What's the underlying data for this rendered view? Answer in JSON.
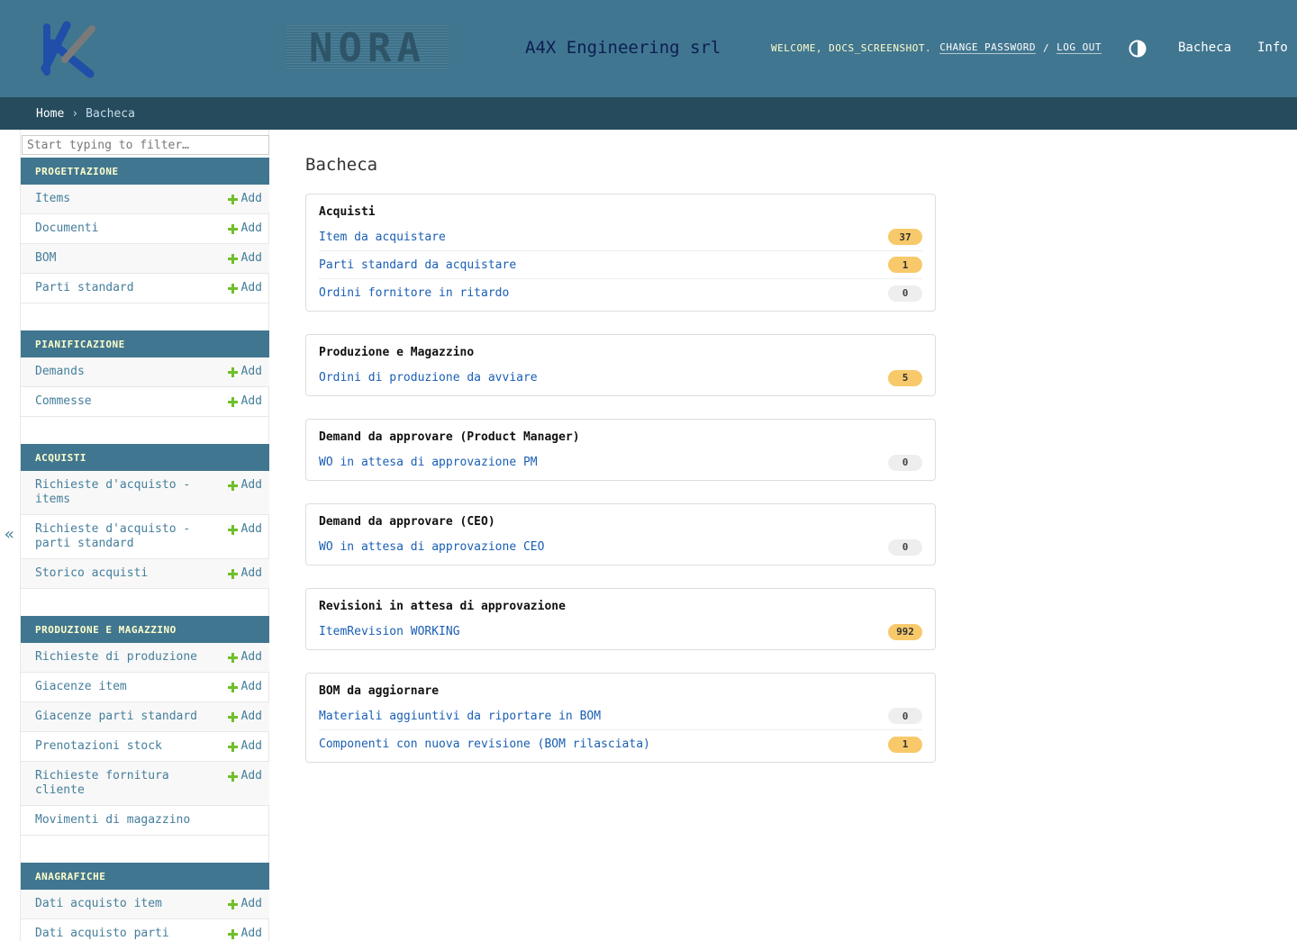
{
  "header": {
    "company": "A4X Engineering srl",
    "nora_logo_text": "NORA",
    "welcome": "WELCOME, DOCS_SCREENSHOT.",
    "change_password": "CHANGE PASSWORD",
    "separator": "/",
    "logout": "LOG OUT",
    "nav": [
      "Bacheca",
      "Info"
    ],
    "colors": {
      "header_bg": "#417690",
      "breadcrumb_bg": "#264b5d",
      "logo_blue": "#1f4fa8",
      "logo_gray": "#7a7a7a"
    }
  },
  "breadcrumb": {
    "home": "Home",
    "sep": "›",
    "current": "Bacheca"
  },
  "sidebar": {
    "filter_placeholder": "Start typing to filter…",
    "collapse_icon": "«",
    "add_label": "Add",
    "modules": [
      {
        "title": "PROGETTAZIONE",
        "items": [
          {
            "label": "Items",
            "add": true
          },
          {
            "label": "Documenti",
            "add": true
          },
          {
            "label": "BOM",
            "add": true
          },
          {
            "label": "Parti standard",
            "add": true
          }
        ]
      },
      {
        "title": "PIANIFICAZIONE",
        "items": [
          {
            "label": "Demands",
            "add": true
          },
          {
            "label": "Commesse",
            "add": true
          }
        ]
      },
      {
        "title": "ACQUISTI",
        "items": [
          {
            "label": "Richieste d'acquisto - items",
            "add": true
          },
          {
            "label": "Richieste d'acquisto - parti standard",
            "add": true
          },
          {
            "label": "Storico acquisti",
            "add": true
          }
        ]
      },
      {
        "title": "PRODUZIONE E MAGAZZINO",
        "items": [
          {
            "label": "Richieste di produzione",
            "add": true
          },
          {
            "label": "Giacenze item",
            "add": true
          },
          {
            "label": "Giacenze parti standard",
            "add": true
          },
          {
            "label": "Prenotazioni stock",
            "add": true
          },
          {
            "label": "Richieste fornitura cliente",
            "add": true
          },
          {
            "label": "Movimenti di magazzino",
            "add": false
          }
        ]
      },
      {
        "title": "ANAGRAFICHE",
        "items": [
          {
            "label": "Dati acquisto item",
            "add": true
          },
          {
            "label": "Dati acquisto parti",
            "add": true
          }
        ]
      }
    ]
  },
  "main": {
    "title": "Bacheca",
    "cards": [
      {
        "title": "Acquisti",
        "rows": [
          {
            "label": "Item da acquistare",
            "count": "37"
          },
          {
            "label": "Parti standard da acquistare",
            "count": "1"
          },
          {
            "label": "Ordini fornitore in ritardo",
            "count": "0"
          }
        ]
      },
      {
        "title": "Produzione e Magazzino",
        "rows": [
          {
            "label": "Ordini di produzione da avviare",
            "count": "5"
          }
        ]
      },
      {
        "title": "Demand da approvare (Product Manager)",
        "rows": [
          {
            "label": "WO in attesa di approvazione PM",
            "count": "0"
          }
        ]
      },
      {
        "title": "Demand da approvare (CEO)",
        "rows": [
          {
            "label": "WO in attesa di approvazione CEO",
            "count": "0"
          }
        ]
      },
      {
        "title": "Revisioni in attesa di approvazione",
        "rows": [
          {
            "label": "ItemRevision WORKING",
            "count": "992"
          }
        ]
      },
      {
        "title": "BOM da aggiornare",
        "rows": [
          {
            "label": "Materiali aggiuntivi da riportare in BOM",
            "count": "0"
          },
          {
            "label": "Componenti con nuova revisione (BOM rilasciata)",
            "count": "1"
          }
        ]
      }
    ]
  }
}
